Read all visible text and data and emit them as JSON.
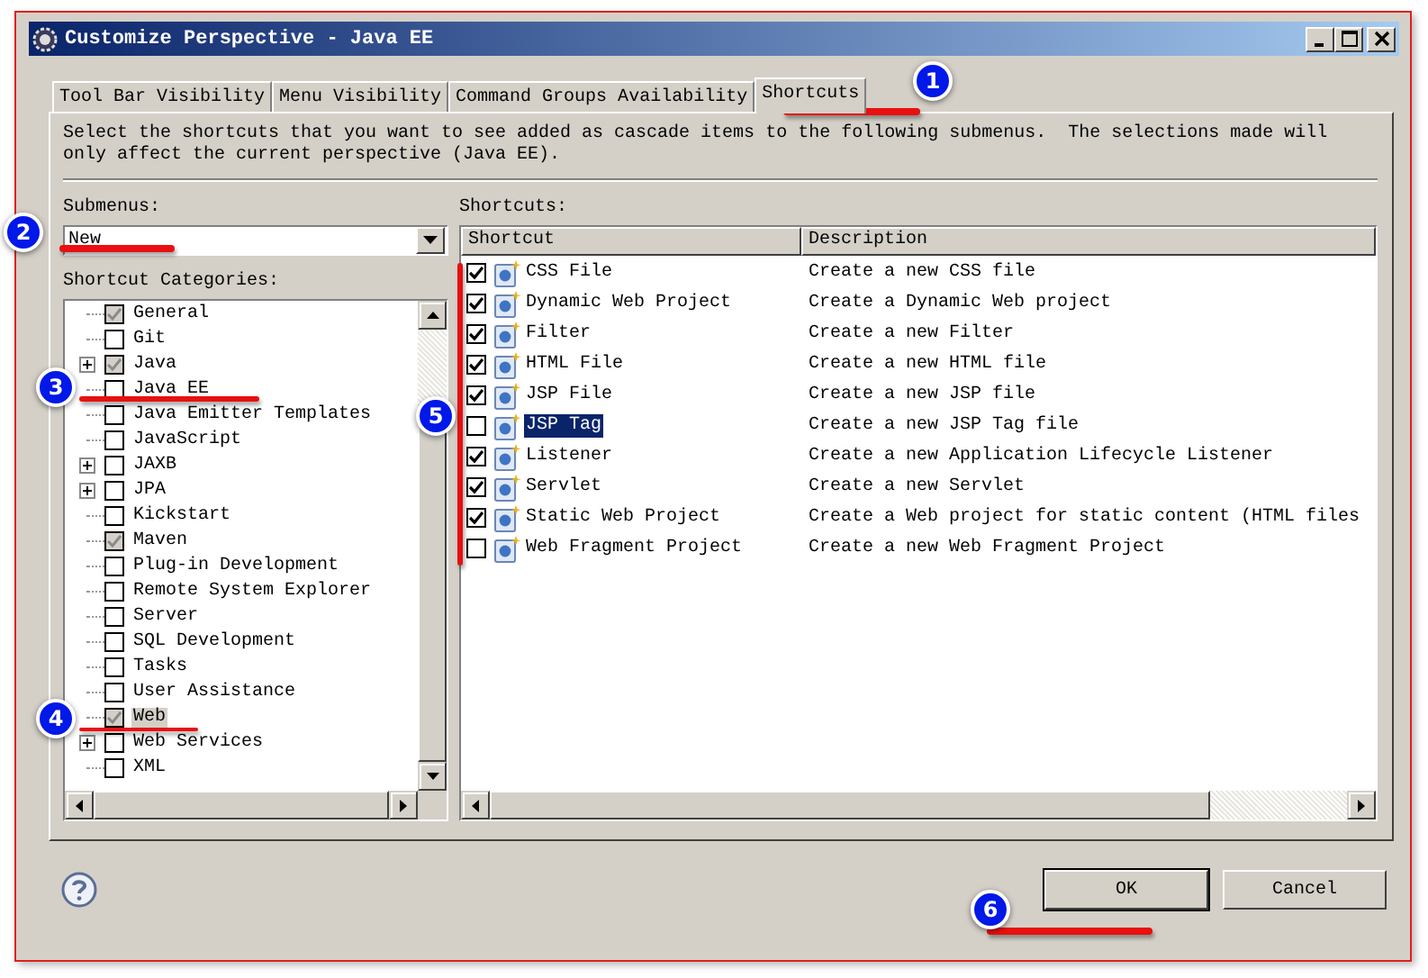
{
  "window": {
    "title": "Customize Perspective - Java EE"
  },
  "tabs": [
    {
      "label": "Tool Bar Visibility",
      "selected": false
    },
    {
      "label": "Menu Visibility",
      "selected": false
    },
    {
      "label": "Command Groups Availability",
      "selected": false
    },
    {
      "label": "Shortcuts",
      "selected": true
    }
  ],
  "description": "Select the shortcuts that you want to see added as cascade items to the following submenus.  The selections made will only affect the current perspective (Java EE).",
  "submenus": {
    "label": "Submenus:",
    "value": "New"
  },
  "categories": {
    "label": "Shortcut Categories:",
    "items": [
      {
        "label": "General",
        "checked": true,
        "expandable": false,
        "selected": false
      },
      {
        "label": "Git",
        "checked": false,
        "expandable": false,
        "selected": false
      },
      {
        "label": "Java",
        "checked": true,
        "expandable": true,
        "selected": false
      },
      {
        "label": "Java EE",
        "checked": false,
        "expandable": false,
        "selected": false
      },
      {
        "label": "Java Emitter Templates",
        "checked": false,
        "expandable": false,
        "selected": false
      },
      {
        "label": "JavaScript",
        "checked": false,
        "expandable": false,
        "selected": false
      },
      {
        "label": "JAXB",
        "checked": false,
        "expandable": true,
        "selected": false
      },
      {
        "label": "JPA",
        "checked": false,
        "expandable": true,
        "selected": false
      },
      {
        "label": "Kickstart",
        "checked": false,
        "expandable": false,
        "selected": false
      },
      {
        "label": "Maven",
        "checked": true,
        "expandable": false,
        "selected": false
      },
      {
        "label": "Plug-in Development",
        "checked": false,
        "expandable": false,
        "selected": false
      },
      {
        "label": "Remote System Explorer",
        "checked": false,
        "expandable": false,
        "selected": false
      },
      {
        "label": "Server",
        "checked": false,
        "expandable": false,
        "selected": false
      },
      {
        "label": "SQL Development",
        "checked": false,
        "expandable": false,
        "selected": false
      },
      {
        "label": "Tasks",
        "checked": false,
        "expandable": false,
        "selected": false
      },
      {
        "label": "User Assistance",
        "checked": false,
        "expandable": false,
        "selected": false
      },
      {
        "label": "Web",
        "checked": true,
        "expandable": false,
        "selected": true
      },
      {
        "label": "Web Services",
        "checked": false,
        "expandable": true,
        "selected": false
      },
      {
        "label": "XML",
        "checked": false,
        "expandable": false,
        "selected": false
      }
    ]
  },
  "shortcuts": {
    "label": "Shortcuts:",
    "columns": [
      "Shortcut",
      "Description"
    ],
    "rows": [
      {
        "name": "CSS File",
        "description": "Create a new CSS file",
        "checked": true,
        "selected": false
      },
      {
        "name": "Dynamic Web Project",
        "description": "Create a Dynamic Web project",
        "checked": true,
        "selected": false
      },
      {
        "name": "Filter",
        "description": "Create a new Filter",
        "checked": true,
        "selected": false
      },
      {
        "name": "HTML File",
        "description": "Create a new HTML file",
        "checked": true,
        "selected": false
      },
      {
        "name": "JSP File",
        "description": "Create a new JSP file",
        "checked": true,
        "selected": false
      },
      {
        "name": "JSP Tag",
        "description": "Create a new JSP Tag file",
        "checked": false,
        "selected": true
      },
      {
        "name": "Listener",
        "description": "Create a new Application Lifecycle Listener",
        "checked": true,
        "selected": false
      },
      {
        "name": "Servlet",
        "description": "Create a new Servlet",
        "checked": true,
        "selected": false
      },
      {
        "name": "Static Web Project",
        "description": "Create a Web project for static content (HTML files",
        "checked": true,
        "selected": false
      },
      {
        "name": "Web Fragment Project",
        "description": "Create a new Web Fragment Project",
        "checked": false,
        "selected": false
      }
    ]
  },
  "buttons": [
    {
      "label": "OK",
      "default": true
    },
    {
      "label": "Cancel",
      "default": false
    }
  ],
  "annotations": [
    {
      "number": "1"
    },
    {
      "number": "2"
    },
    {
      "number": "3"
    },
    {
      "number": "4"
    },
    {
      "number": "5"
    },
    {
      "number": "6"
    }
  ]
}
